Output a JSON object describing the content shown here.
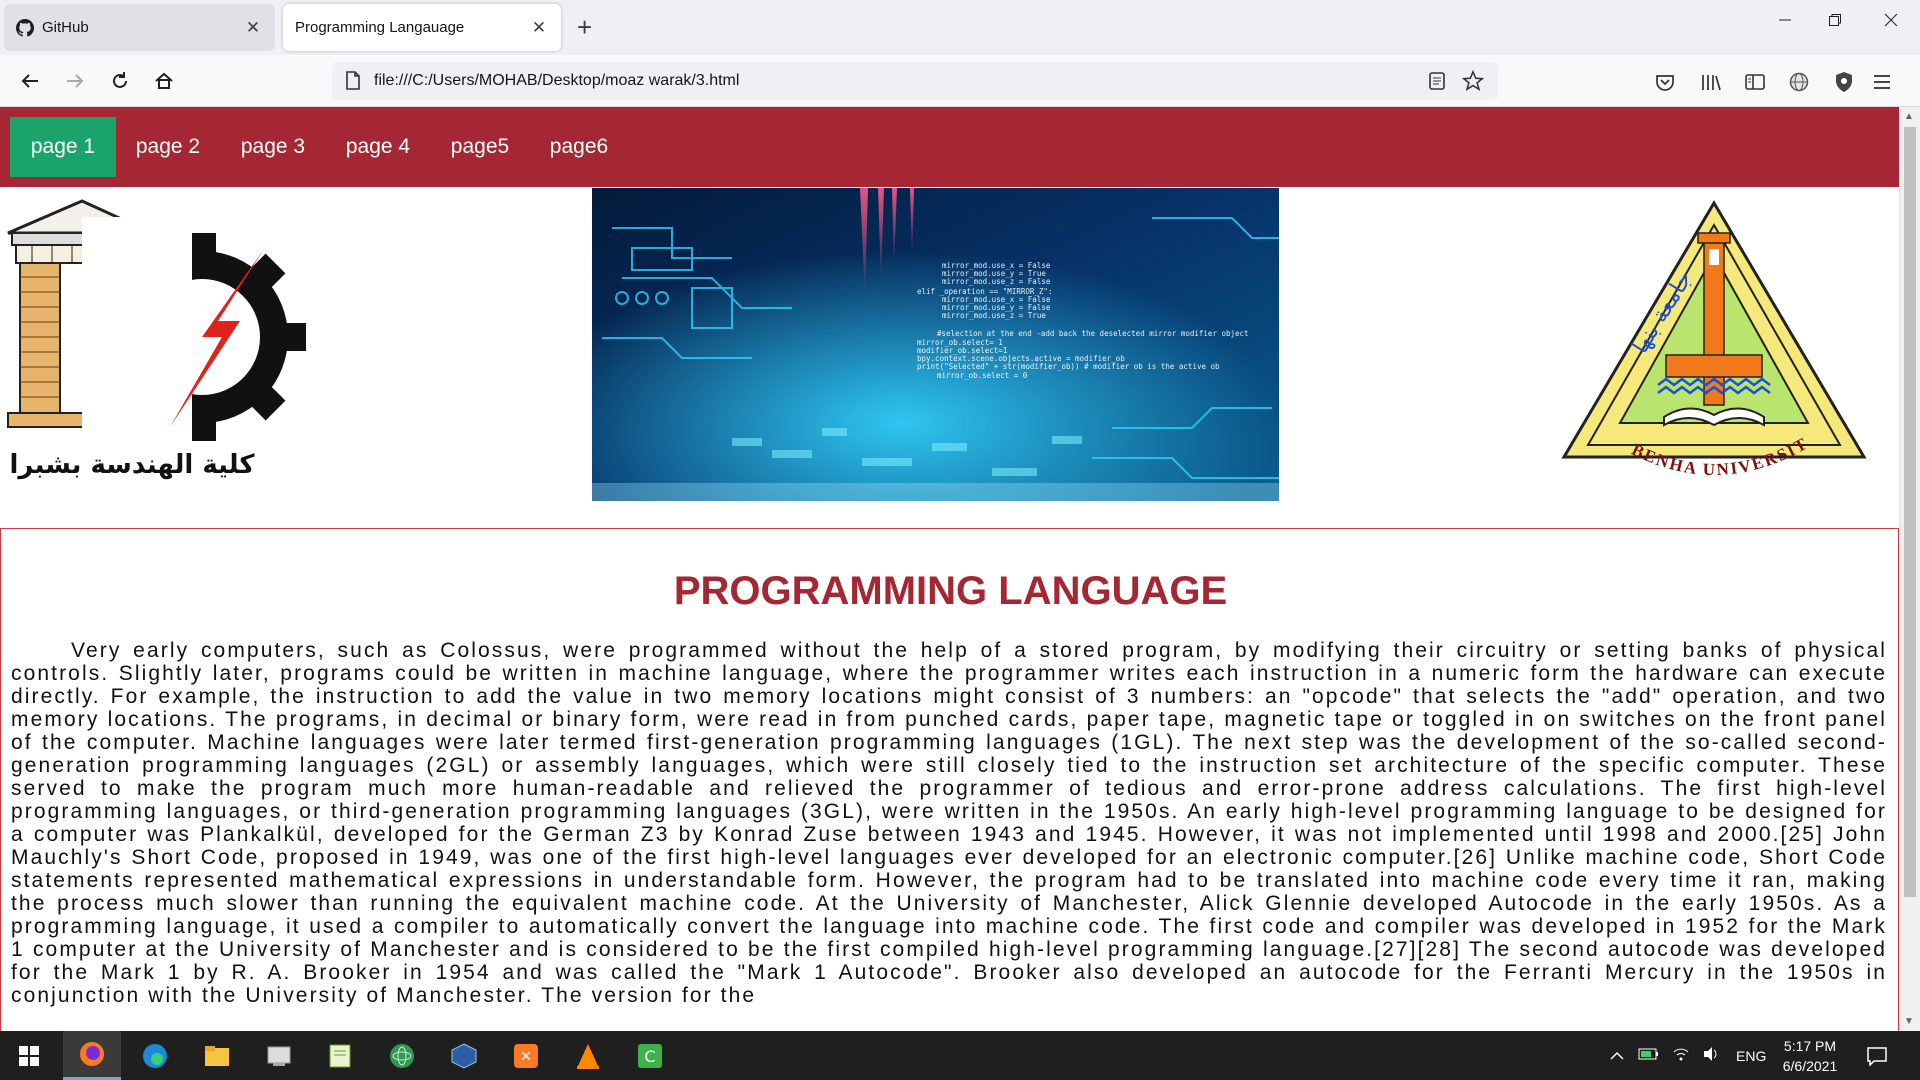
{
  "browser": {
    "tabs": [
      {
        "title": "GitHub",
        "active": false,
        "icon": "github-icon"
      },
      {
        "title": "Programming Langauage",
        "active": true,
        "icon": "none"
      }
    ],
    "new_tab_label": "+",
    "close_glyph": "✕",
    "url": "file:///C:/Users/MOHAB/Desktop/moaz warak/3.html"
  },
  "site_nav": {
    "items": [
      {
        "label": "page 1",
        "active": true
      },
      {
        "label": "page 2",
        "active": false
      },
      {
        "label": "page 3",
        "active": false
      },
      {
        "label": "page 4",
        "active": false
      },
      {
        "label": "page5",
        "active": false
      },
      {
        "label": "page6",
        "active": false
      }
    ]
  },
  "logos": {
    "left_caption": "كلية الهندسة بشبرا",
    "right_caption": "BENHA UNIVERSITY",
    "right_arabic": "جامعة بنها"
  },
  "content": {
    "heading": "PROGRAMMING LANGUAGE",
    "body": "Very early computers, such as Colossus, were programmed without the help of a stored program, by modifying their circuitry or setting banks of physical controls. Slightly later, programs could be written in machine language, where the programmer writes each instruction in a numeric form the hardware can execute directly. For example, the instruction to add the value in two memory locations might consist of 3 numbers: an \"opcode\" that selects the \"add\" operation, and two memory locations. The programs, in decimal or binary form, were read in from punched cards, paper tape, magnetic tape or toggled in on switches on the front panel of the computer. Machine languages were later termed first-generation programming languages (1GL). The next step was the development of the so-called second-generation programming languages (2GL) or assembly languages, which were still closely tied to the instruction set architecture of the specific computer. These served to make the program much more human-readable and relieved the programmer of tedious and error-prone address calculations. The first high-level programming languages, or third-generation programming languages (3GL), were written in the 1950s. An early high-level programming language to be designed for a computer was Plankalkül, developed for the German Z3 by Konrad Zuse between 1943 and 1945. However, it was not implemented until 1998 and 2000.[25] John Mauchly's Short Code, proposed in 1949, was one of the first high-level languages ever developed for an electronic computer.[26] Unlike machine code, Short Code statements represented mathematical expressions in understandable form. However, the program had to be translated into machine code every time it ran, making the process much slower than running the equivalent machine code. At the University of Manchester, Alick Glennie developed Autocode in the early 1950s. As a programming language, it used a compiler to automatically convert the language into machine code. The first code and compiler was developed in 1952 for the Mark 1 computer at the University of Manchester and is considered to be the first compiled high-level programming language.[27][28] The second autocode was developed for the Mark 1 by R. A. Brooker in 1954 and was called the \"Mark 1 Autocode\". Brooker also developed an autocode for the Ferranti Mercury in the 1950s in conjunction with the University of Manchester. The version for the"
  },
  "taskbar": {
    "apps": [
      "start-icon",
      "firefox-icon",
      "edge-icon",
      "file-explorer-icon",
      "app-icon",
      "notepad-icon",
      "atom-icon",
      "virtualbox-icon",
      "xampp-icon",
      "vlc-icon",
      "camtasia-icon"
    ],
    "language": "ENG",
    "time": "5:17 PM",
    "date": "6/6/2021"
  },
  "colors": {
    "nav_bg": "#a52734",
    "nav_active": "#1aa36b",
    "heading": "#a52734"
  }
}
